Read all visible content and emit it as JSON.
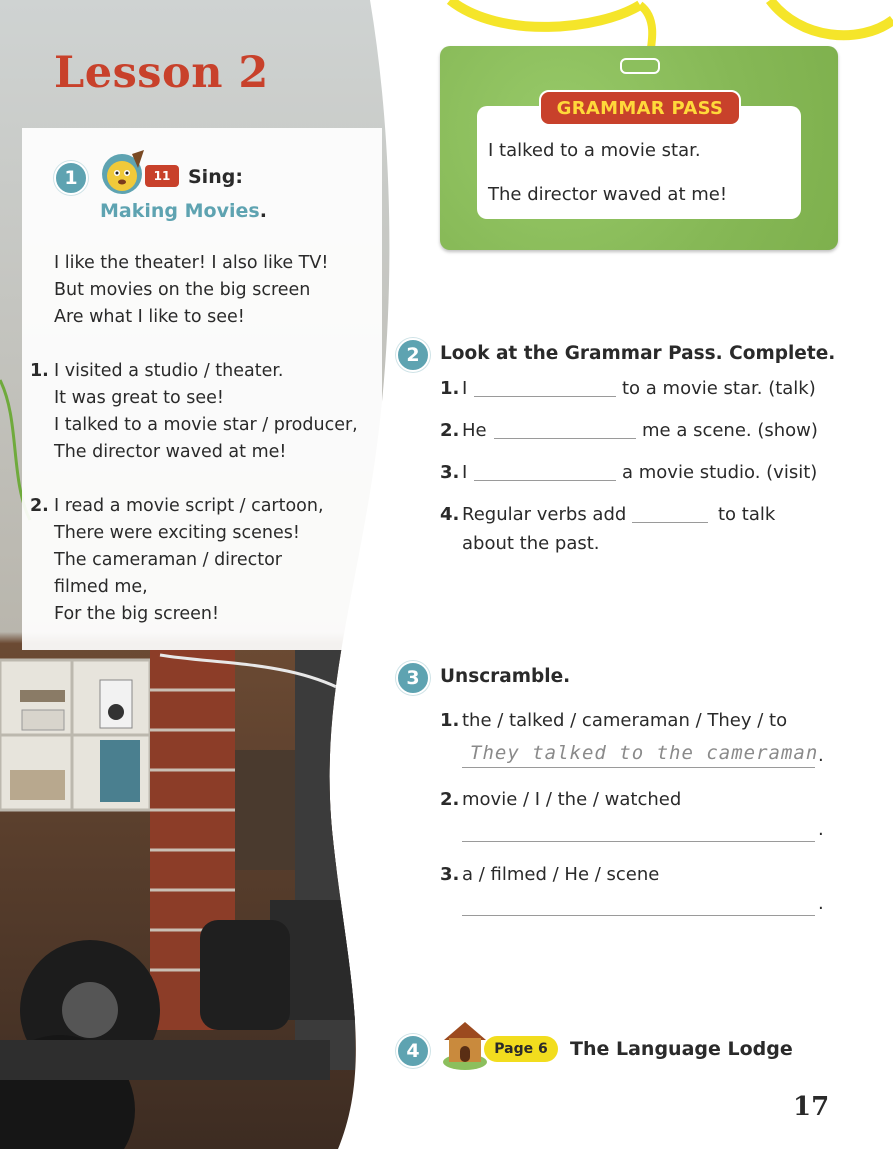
{
  "lesson_title": "Lesson 2",
  "song": {
    "number": "1",
    "track": "11",
    "sing_label": "Sing:",
    "title": "Making Movies",
    "title_end": ".",
    "intro": [
      "I like the theater! I also like TV!",
      "But movies on the big screen",
      "Are what I like to see!"
    ],
    "verse1_number": "1.",
    "verse1": [
      "I visited a studio  / theater.",
      "It was great to see!",
      "I talked to a movie star / producer,",
      "The director waved at me!"
    ],
    "verse2_number": "2.",
    "verse2": [
      "I read a movie script / cartoon,",
      "There were exciting scenes!",
      "The cameraman / director",
      "filmed me,",
      "For the big screen!"
    ]
  },
  "grammar_pass": {
    "label": "GRAMMAR PASS",
    "sentences": [
      "I talked to a movie star.",
      "The director waved at me!"
    ]
  },
  "exercise2": {
    "number": "2",
    "heading": "Look at the Grammar Pass. Complete.",
    "items": [
      {
        "num": "1.",
        "before": "I",
        "after": "to a movie star. (talk)"
      },
      {
        "num": "2.",
        "before": "He",
        "after": "me a scene. (show)"
      },
      {
        "num": "3.",
        "before": "I",
        "after": "a movie studio. (visit)"
      },
      {
        "num": "4.",
        "before": "Regular verbs add",
        "after": "to talk",
        "line2": "about the past."
      }
    ]
  },
  "exercise3": {
    "number": "3",
    "heading": "Unscramble.",
    "items": [
      {
        "num": "1.",
        "words": "the / talked / cameraman / They / to",
        "answer": "They talked to the cameraman"
      },
      {
        "num": "2.",
        "words": "movie / I / the / watched",
        "answer": ""
      },
      {
        "num": "3.",
        "words": "a / filmed / He / scene",
        "answer": ""
      }
    ],
    "period": "."
  },
  "exercise4": {
    "number": "4",
    "page_badge": "Page 6",
    "title": "The Language Lodge"
  },
  "page_number": "17",
  "colors": {
    "lesson_red": "#c8412b",
    "teal": "#5ea3b1",
    "pass_green": "#8cbf5d",
    "badge_yellow": "#f2dd1e",
    "lanyard_yellow": "#f5e52a"
  }
}
